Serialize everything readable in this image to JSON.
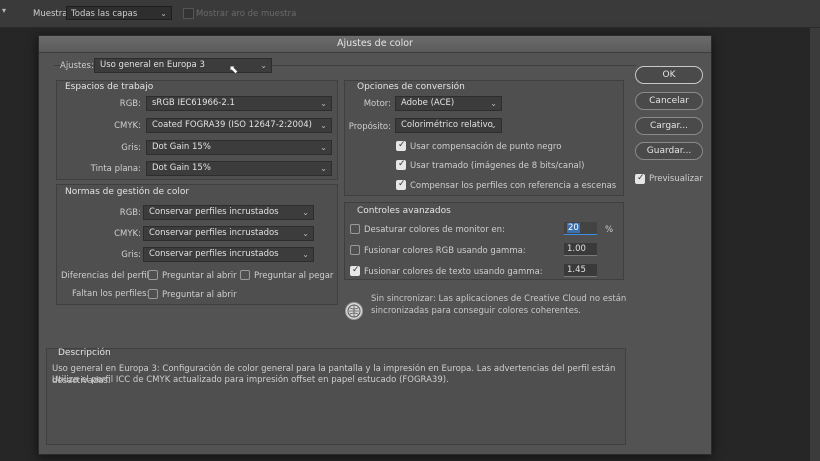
{
  "topbar": {
    "muestra_label": "Muestra:",
    "muestra_value": "Todas las capas",
    "checkbox_label": "Mostrar aro de muestra"
  },
  "dialog": {
    "title": "Ajustes de color",
    "ajustes_label": "Ajustes:",
    "ajustes_value": "Uso general en Europa 3",
    "espacios": {
      "title": "Espacios de trabajo",
      "rgb_label": "RGB:",
      "rgb_value": "sRGB IEC61966-2.1",
      "cmyk_label": "CMYK:",
      "cmyk_value": "Coated FOGRA39 (ISO 12647-2:2004)",
      "gris_label": "Gris:",
      "gris_value": "Dot Gain 15%",
      "tinta_label": "Tinta plana:",
      "tinta_value": "Dot Gain 15%"
    },
    "normas": {
      "title": "Normas de gestión de color",
      "rgb_label": "RGB:",
      "rgb_value": "Conservar perfiles incrustados",
      "cmyk_label": "CMYK:",
      "cmyk_value": "Conservar perfiles incrustados",
      "gris_label": "Gris:",
      "gris_value": "Conservar perfiles incrustados",
      "diferencias_label": "Diferencias del perfil:",
      "preguntar_abrir": "Preguntar al abrir",
      "preguntar_pegar": "Preguntar al pegar",
      "faltan_label": "Faltan los perfiles:",
      "faltan_preguntar_abrir": "Preguntar al abrir"
    },
    "conversion": {
      "title": "Opciones de conversión",
      "motor_label": "Motor:",
      "motor_value": "Adobe (ACE)",
      "proposito_label": "Propósito:",
      "proposito_value": "Colorimétrico relativo",
      "opt1": "Usar compensación de punto negro",
      "opt2": "Usar tramado (imágenes de 8 bits/canal)",
      "opt3": "Compensar los perfiles con referencia a escenas"
    },
    "avanzados": {
      "title": "Controles avanzados",
      "desaturar_label": "Desaturar colores de monitor en:",
      "desaturar_value": "20",
      "desaturar_unit": "%",
      "fusionar_rgb_label": "Fusionar colores RGB usando gamma:",
      "fusionar_rgb_value": "1.00",
      "fusionar_texto_label": "Fusionar colores de texto usando gamma:",
      "fusionar_texto_value": "1.45"
    },
    "sync_text_1": "Sin sincronizar: Las aplicaciones de Creative Cloud no están",
    "sync_text_2": "sincronizadas para conseguir colores coherentes.",
    "descripcion": {
      "title": "Descripción",
      "line1": "Uso general en Europa 3:  Configuración de color general para la pantalla y la impresión en Europa. Las advertencias del perfil están desactivadas.",
      "line2": "Utiliza el perfil ICC de CMYK actualizado para impresión offset en papel estucado (FOGRA39)."
    },
    "buttons": {
      "ok": "OK",
      "cancelar": "Cancelar",
      "cargar": "Cargar...",
      "guardar": "Guardar...",
      "previsualizar": "Previsualizar"
    }
  }
}
